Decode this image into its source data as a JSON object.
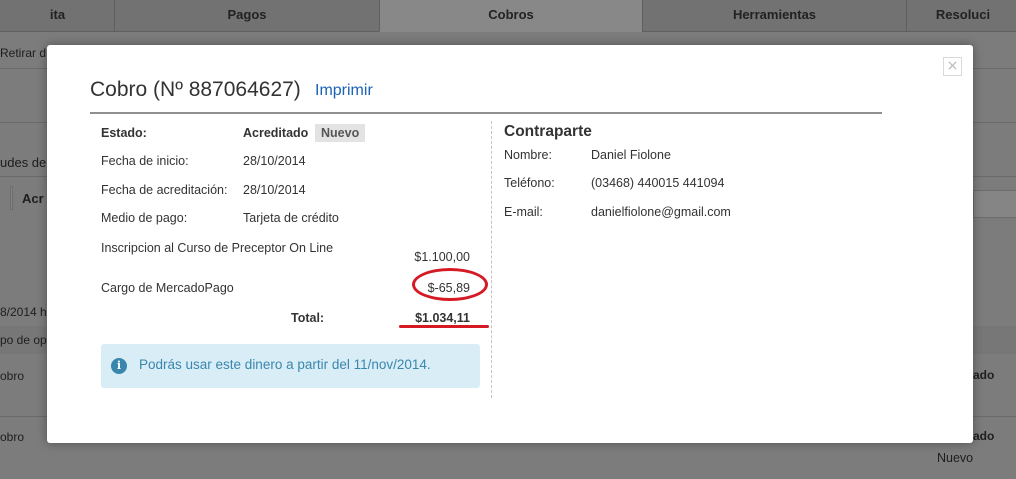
{
  "background": {
    "tabs": [
      {
        "label": "ita"
      },
      {
        "label": "Pagos"
      },
      {
        "label": "Cobros"
      },
      {
        "label": "Herramientas"
      },
      {
        "label": "Resoluci"
      }
    ],
    "retirar_text": "Retirar d",
    "fragments": {
      "udes": "udes de",
      "acr": "Acr",
      "date": "8/2014 h",
      "tipo": "po de ope",
      "cobro1": "obro",
      "cobro2": "obro",
      "estado1": "ado",
      "estado2": "ado",
      "nuevo": "Nuevo"
    }
  },
  "modal": {
    "close_icon": "×",
    "title": "Cobro (Nº 887064627)",
    "print_label": "Imprimir",
    "details": {
      "estado_label": "Estado:",
      "estado_value": "Acreditado",
      "estado_badge": "Nuevo",
      "fecha_inicio_label": "Fecha de inicio:",
      "fecha_inicio_value": "28/10/2014",
      "fecha_acreditacion_label": "Fecha de acreditación:",
      "fecha_acreditacion_value": "28/10/2014",
      "medio_pago_label": "Medio de pago:",
      "medio_pago_value": "Tarjeta de crédito"
    },
    "items": [
      {
        "description": "Inscripcion al Curso de Preceptor On Line",
        "amount": "$1.100,00"
      },
      {
        "description": "Cargo de MercadoPago",
        "amount": "$-65,89"
      }
    ],
    "total_label": "Total:",
    "total_value": "$1.034,11",
    "info_message": "Podrás usar este dinero a partir del 11/nov/2014.",
    "counterparty": {
      "heading": "Contraparte",
      "nombre_label": "Nombre:",
      "nombre_value": "Daniel Fiolone",
      "telefono_label": "Teléfono:",
      "telefono_value": "(03468) 440015 441094",
      "email_label": "E-mail:",
      "email_value": "danielfiolone@gmail.com"
    }
  },
  "colors": {
    "link": "#1a62b4",
    "annotation_red": "#d51a24",
    "info_bg": "#d9edf7",
    "info_text": "#3a87ad"
  }
}
